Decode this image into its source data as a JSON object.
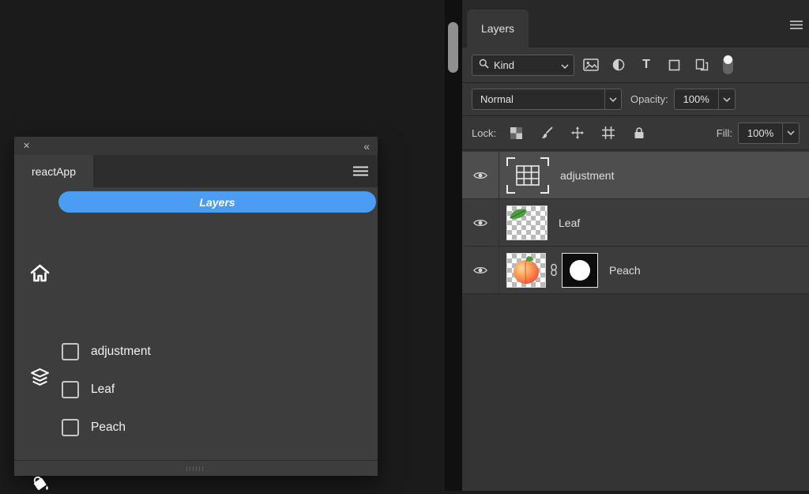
{
  "colors": {
    "accent_blue": "#4a9df0",
    "selected_row": "#4e4e4e"
  },
  "icons": {
    "type_filter_glyph": "T"
  },
  "plugin": {
    "close_icon": "✕",
    "collapse_icon": "«",
    "tab_label": "reactApp",
    "pill_label": "Layers",
    "items": [
      {
        "label": "adjustment",
        "checked": false
      },
      {
        "label": "Leaf",
        "checked": false
      },
      {
        "label": "Peach",
        "checked": false
      }
    ]
  },
  "layers_panel": {
    "tab_label": "Layers",
    "filter": {
      "kind_label": "Kind"
    },
    "blend": {
      "mode_value": "Normal",
      "opacity_label": "Opacity:",
      "opacity_value": "100%"
    },
    "lock": {
      "label": "Lock:",
      "fill_label": "Fill:",
      "fill_value": "100%"
    },
    "layers": [
      {
        "name": "adjustment",
        "selected": true,
        "thumb": "adjustment-grid"
      },
      {
        "name": "Leaf",
        "selected": false,
        "thumb": "leaf-on-transparent"
      },
      {
        "name": "Peach",
        "selected": false,
        "thumb": "peach",
        "linked": true,
        "mask": "white-circle-mask"
      }
    ]
  }
}
